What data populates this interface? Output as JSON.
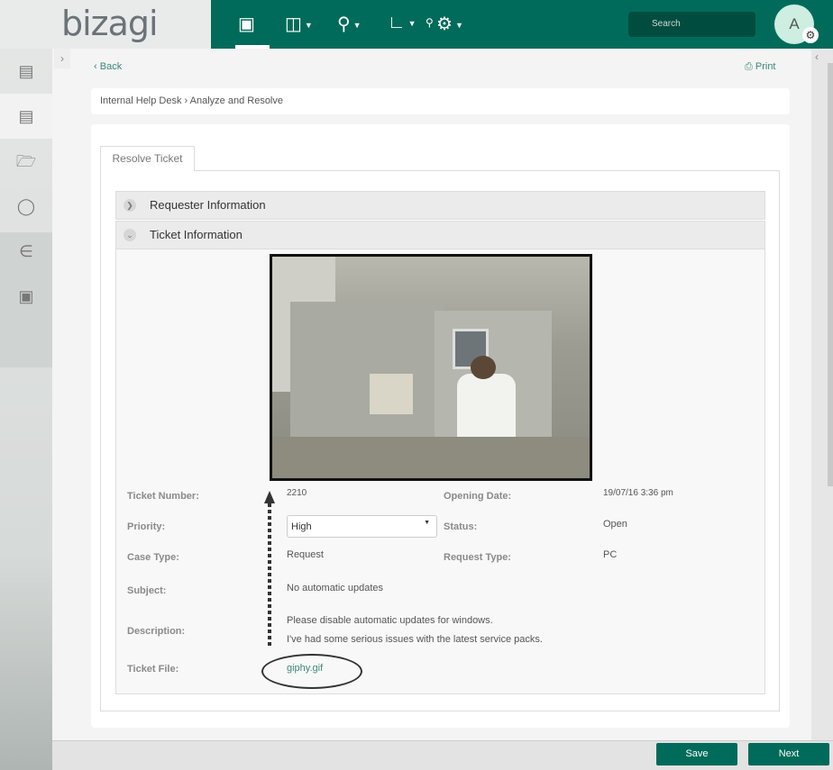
{
  "app": {
    "logo": "bizagi",
    "search_placeholder": "Search",
    "avatar_initial": "A"
  },
  "nav": [
    {
      "icon": "inbox-icon"
    },
    {
      "icon": "new-case-icon"
    },
    {
      "icon": "search-icon"
    },
    {
      "icon": "reports-icon"
    },
    {
      "icon": "admin-gear-icon"
    }
  ],
  "sidebar": [
    {
      "icon": "case-details-icon"
    },
    {
      "icon": "activity-form-icon"
    },
    {
      "icon": "folder-icon"
    },
    {
      "icon": "comments-icon"
    },
    {
      "icon": "attachments-icon"
    },
    {
      "icon": "workflow-icon"
    }
  ],
  "toolbar": {
    "back": "Back",
    "print": "Print"
  },
  "breadcrumb": "Internal Help Desk › Analyze and Resolve",
  "tab": "Resolve Ticket",
  "sections": {
    "requester": "Requester Information",
    "ticket": "Ticket Information"
  },
  "fields": {
    "ticket_number": {
      "label": "Ticket Number:",
      "value": "2210"
    },
    "opening_date": {
      "label": "Opening Date:",
      "value": "19/07/16 3:36 pm"
    },
    "priority": {
      "label": "Priority:",
      "value": "High"
    },
    "status": {
      "label": "Status:",
      "value": "Open"
    },
    "case_type": {
      "label": "Case Type:",
      "value": "Request"
    },
    "request_type": {
      "label": "Request Type:",
      "value": "PC"
    },
    "subject": {
      "label": "Subject:",
      "value": "No automatic updates"
    },
    "description": {
      "label": "Description:",
      "line1": "Please disable automatic updates for windows.",
      "line2": "I've had some serious issues with the latest service packs."
    },
    "ticket_file": {
      "label": "Ticket File:",
      "value": "giphy.gif"
    }
  },
  "footer": {
    "save": "Save",
    "next": "Next"
  },
  "colors": {
    "brand": "#006b5a",
    "link": "#3b8a74"
  }
}
